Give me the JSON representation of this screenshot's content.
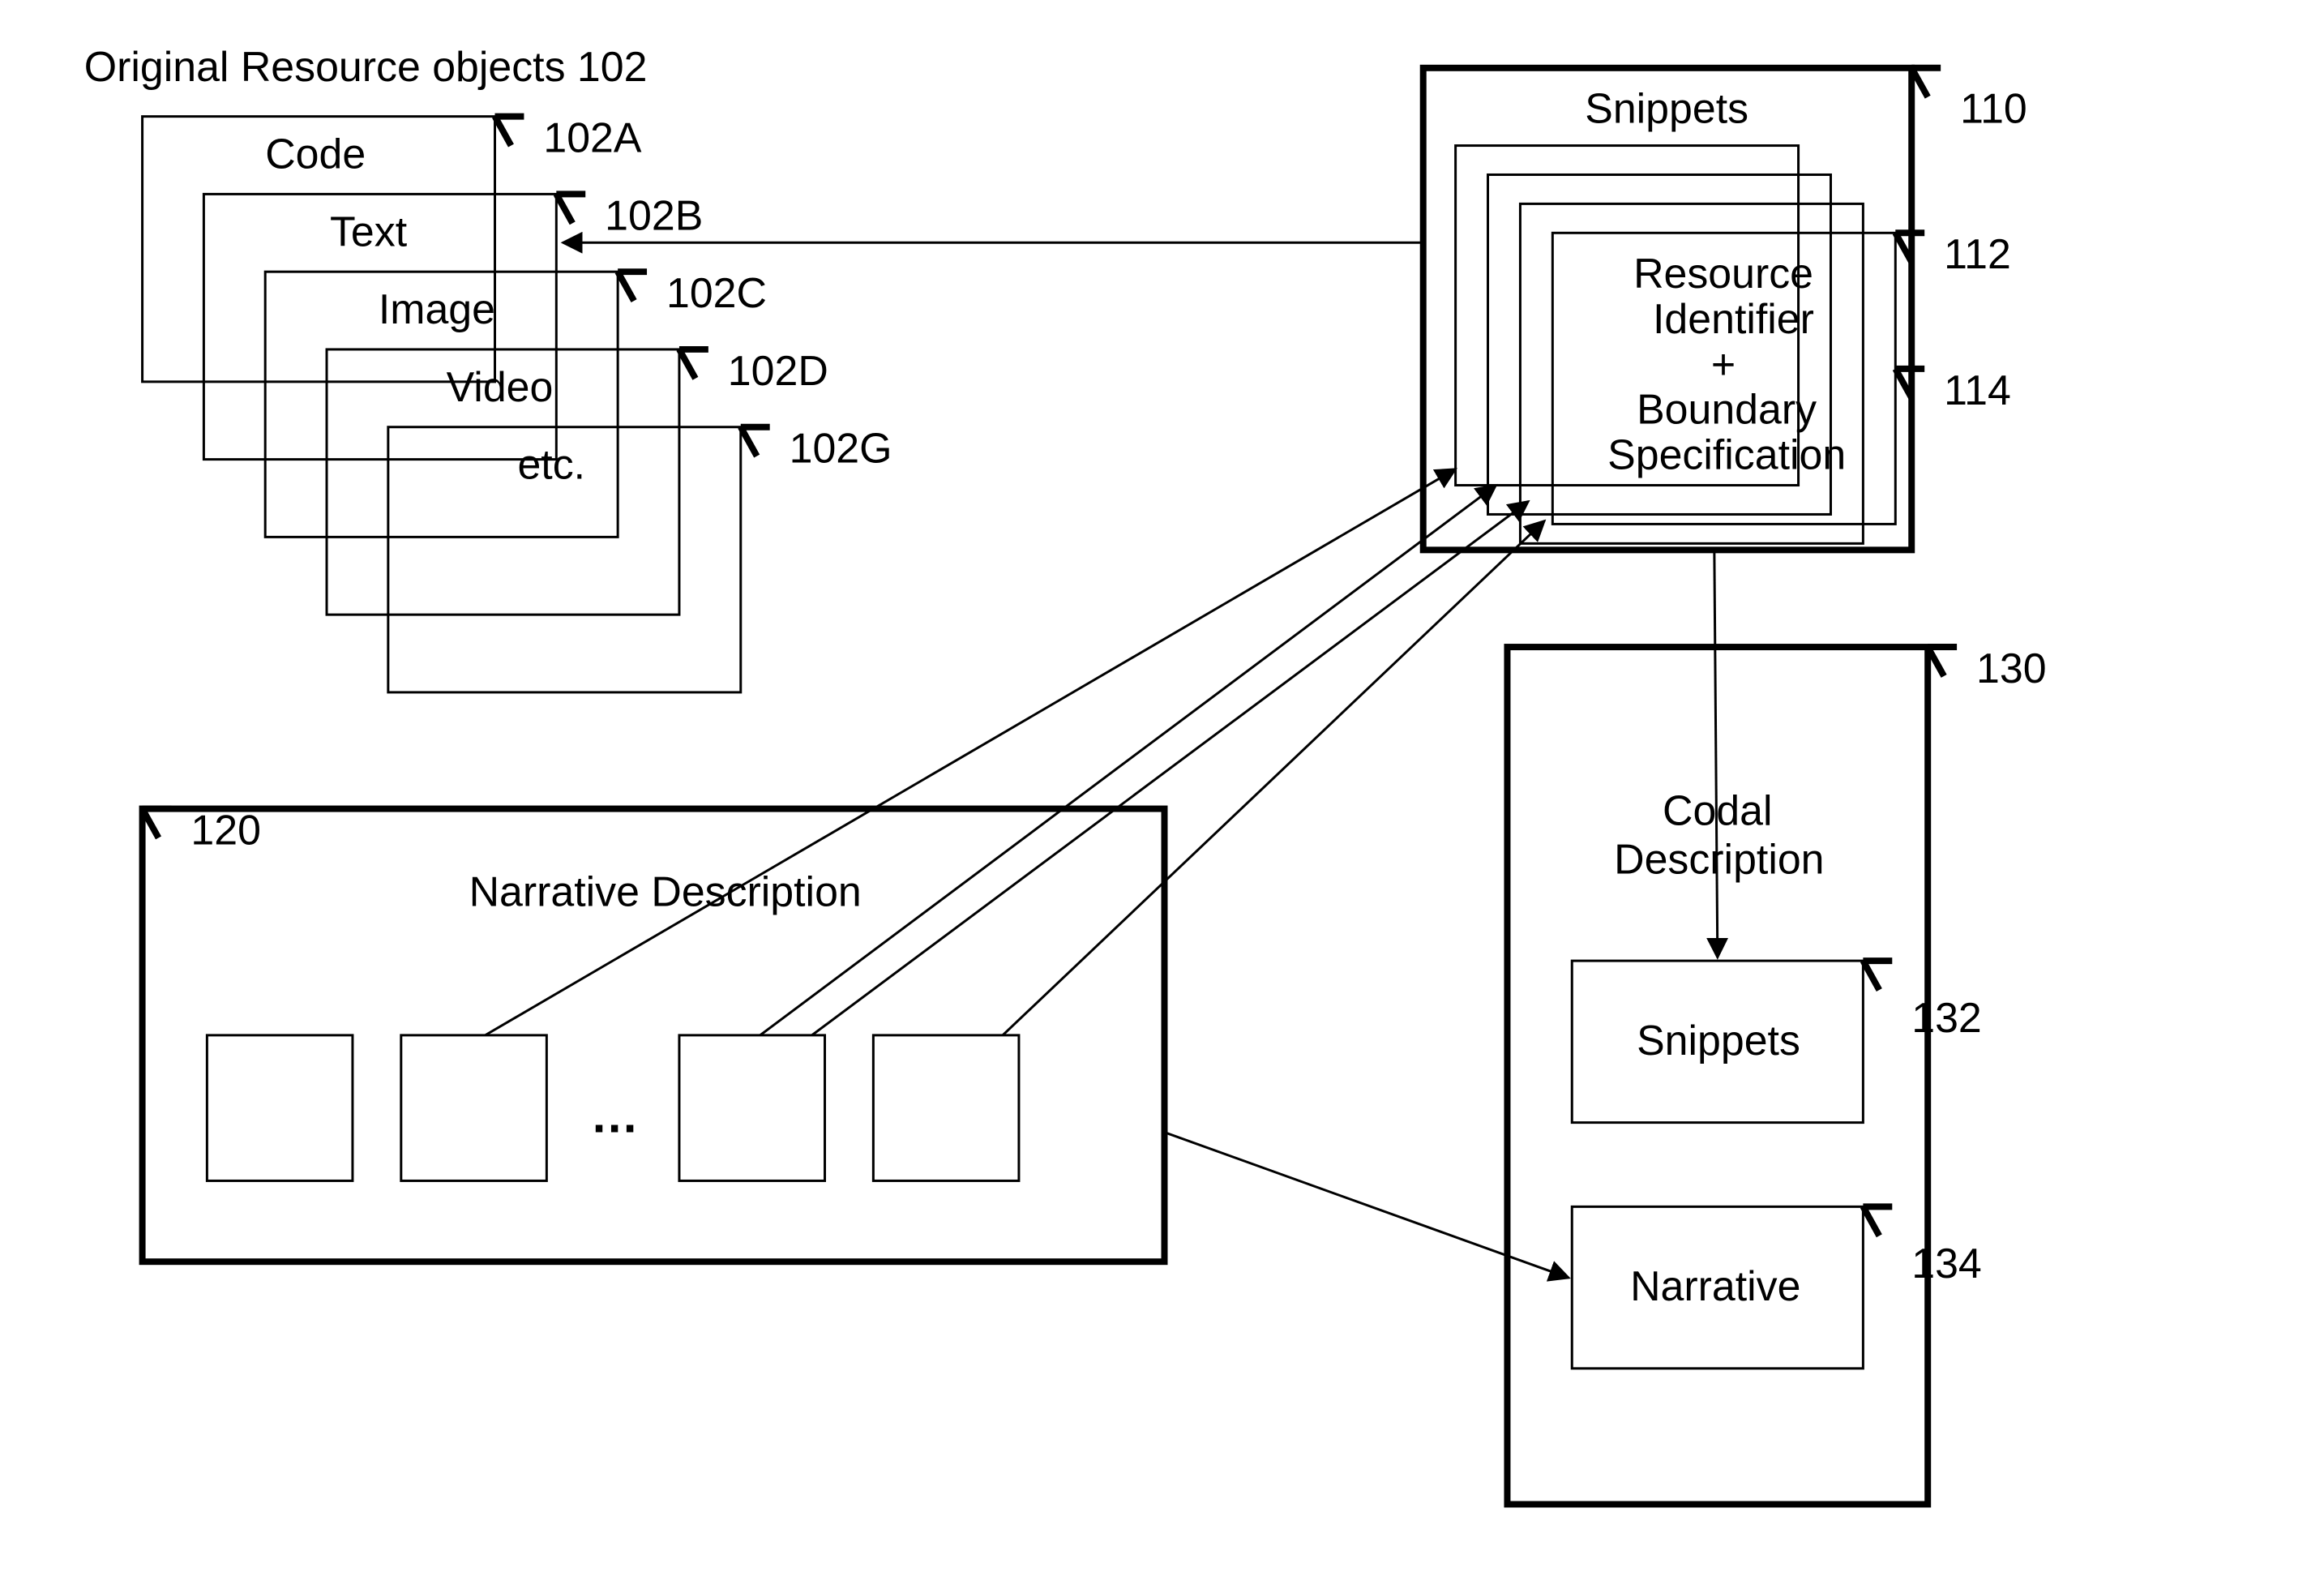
{
  "title": "Original Resource objects 102",
  "resources": {
    "heading": "Original Resource objects 102",
    "items": [
      {
        "label": "Code",
        "ref": "102A"
      },
      {
        "label": "Text",
        "ref": "102B"
      },
      {
        "label": "Image",
        "ref": "102C"
      },
      {
        "label": "Video",
        "ref": "102D"
      },
      {
        "label": "etc.",
        "ref": "102G"
      }
    ]
  },
  "snippets": {
    "title": "Snippets",
    "ref": "110",
    "card": {
      "line1": "Resource",
      "line2": "Identifier",
      "plus": "+",
      "line3": "Boundary",
      "line4": "Specification",
      "ref_top": "112",
      "ref_bottom": "114"
    }
  },
  "narrative": {
    "title": "Narrative Description",
    "ref": "120",
    "ellipsis": "…"
  },
  "codal": {
    "title": "Codal Description",
    "ref": "130",
    "snippets_box": {
      "label": "Snippets",
      "ref": "132"
    },
    "narrative_box": {
      "label": "Narrative",
      "ref": "134"
    }
  }
}
